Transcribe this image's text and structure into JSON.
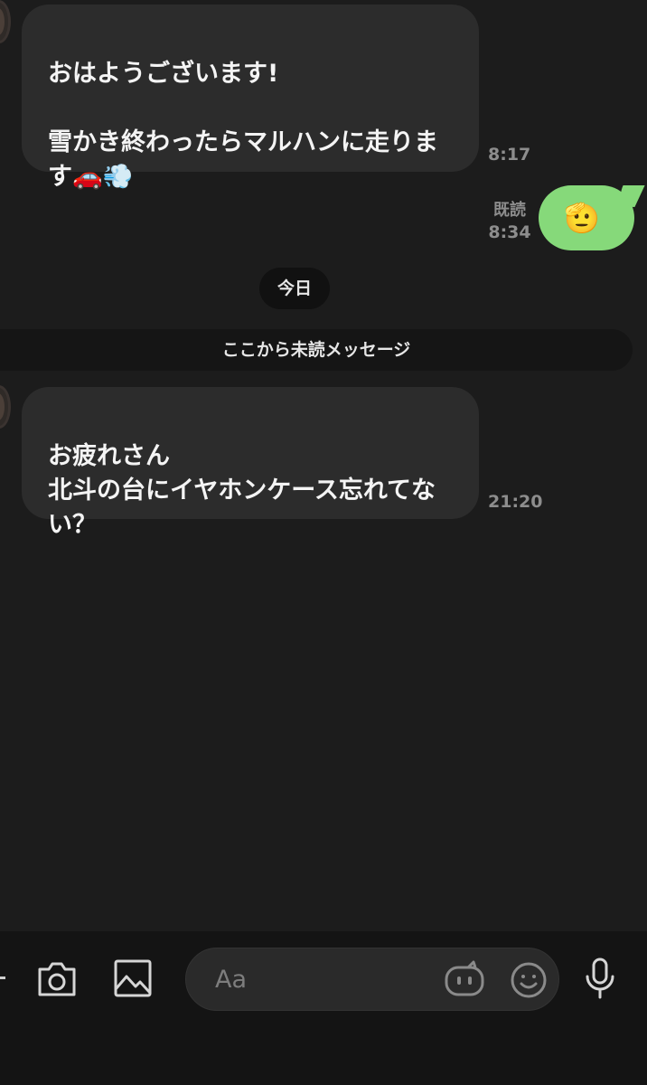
{
  "messages": [
    {
      "direction": "incoming",
      "text": "おはようございます!\n\n雪かき終わったらマルハンに走ります🚗💨",
      "time": "8:17"
    },
    {
      "direction": "outgoing",
      "emoji": "🫡",
      "read_label": "既読",
      "time": "8:34"
    },
    {
      "direction": "incoming",
      "text": "お疲れさん\n北斗の台にイヤホンケース忘れてない？",
      "time": "21:20"
    }
  ],
  "date_separator": "今日",
  "unread_divider": "ここから未読メッセージ",
  "composer": {
    "placeholder": "Aa"
  },
  "icons": {
    "camera": "camera-icon",
    "image": "image-icon",
    "bot": "bot-icon",
    "emoji": "emoji-icon",
    "mic": "microphone-icon"
  },
  "colors": {
    "background": "#1c1c1c",
    "incoming_bubble": "#2c2c2c",
    "outgoing_bubble": "#86d97a",
    "meta_text": "#8d8d8d"
  }
}
